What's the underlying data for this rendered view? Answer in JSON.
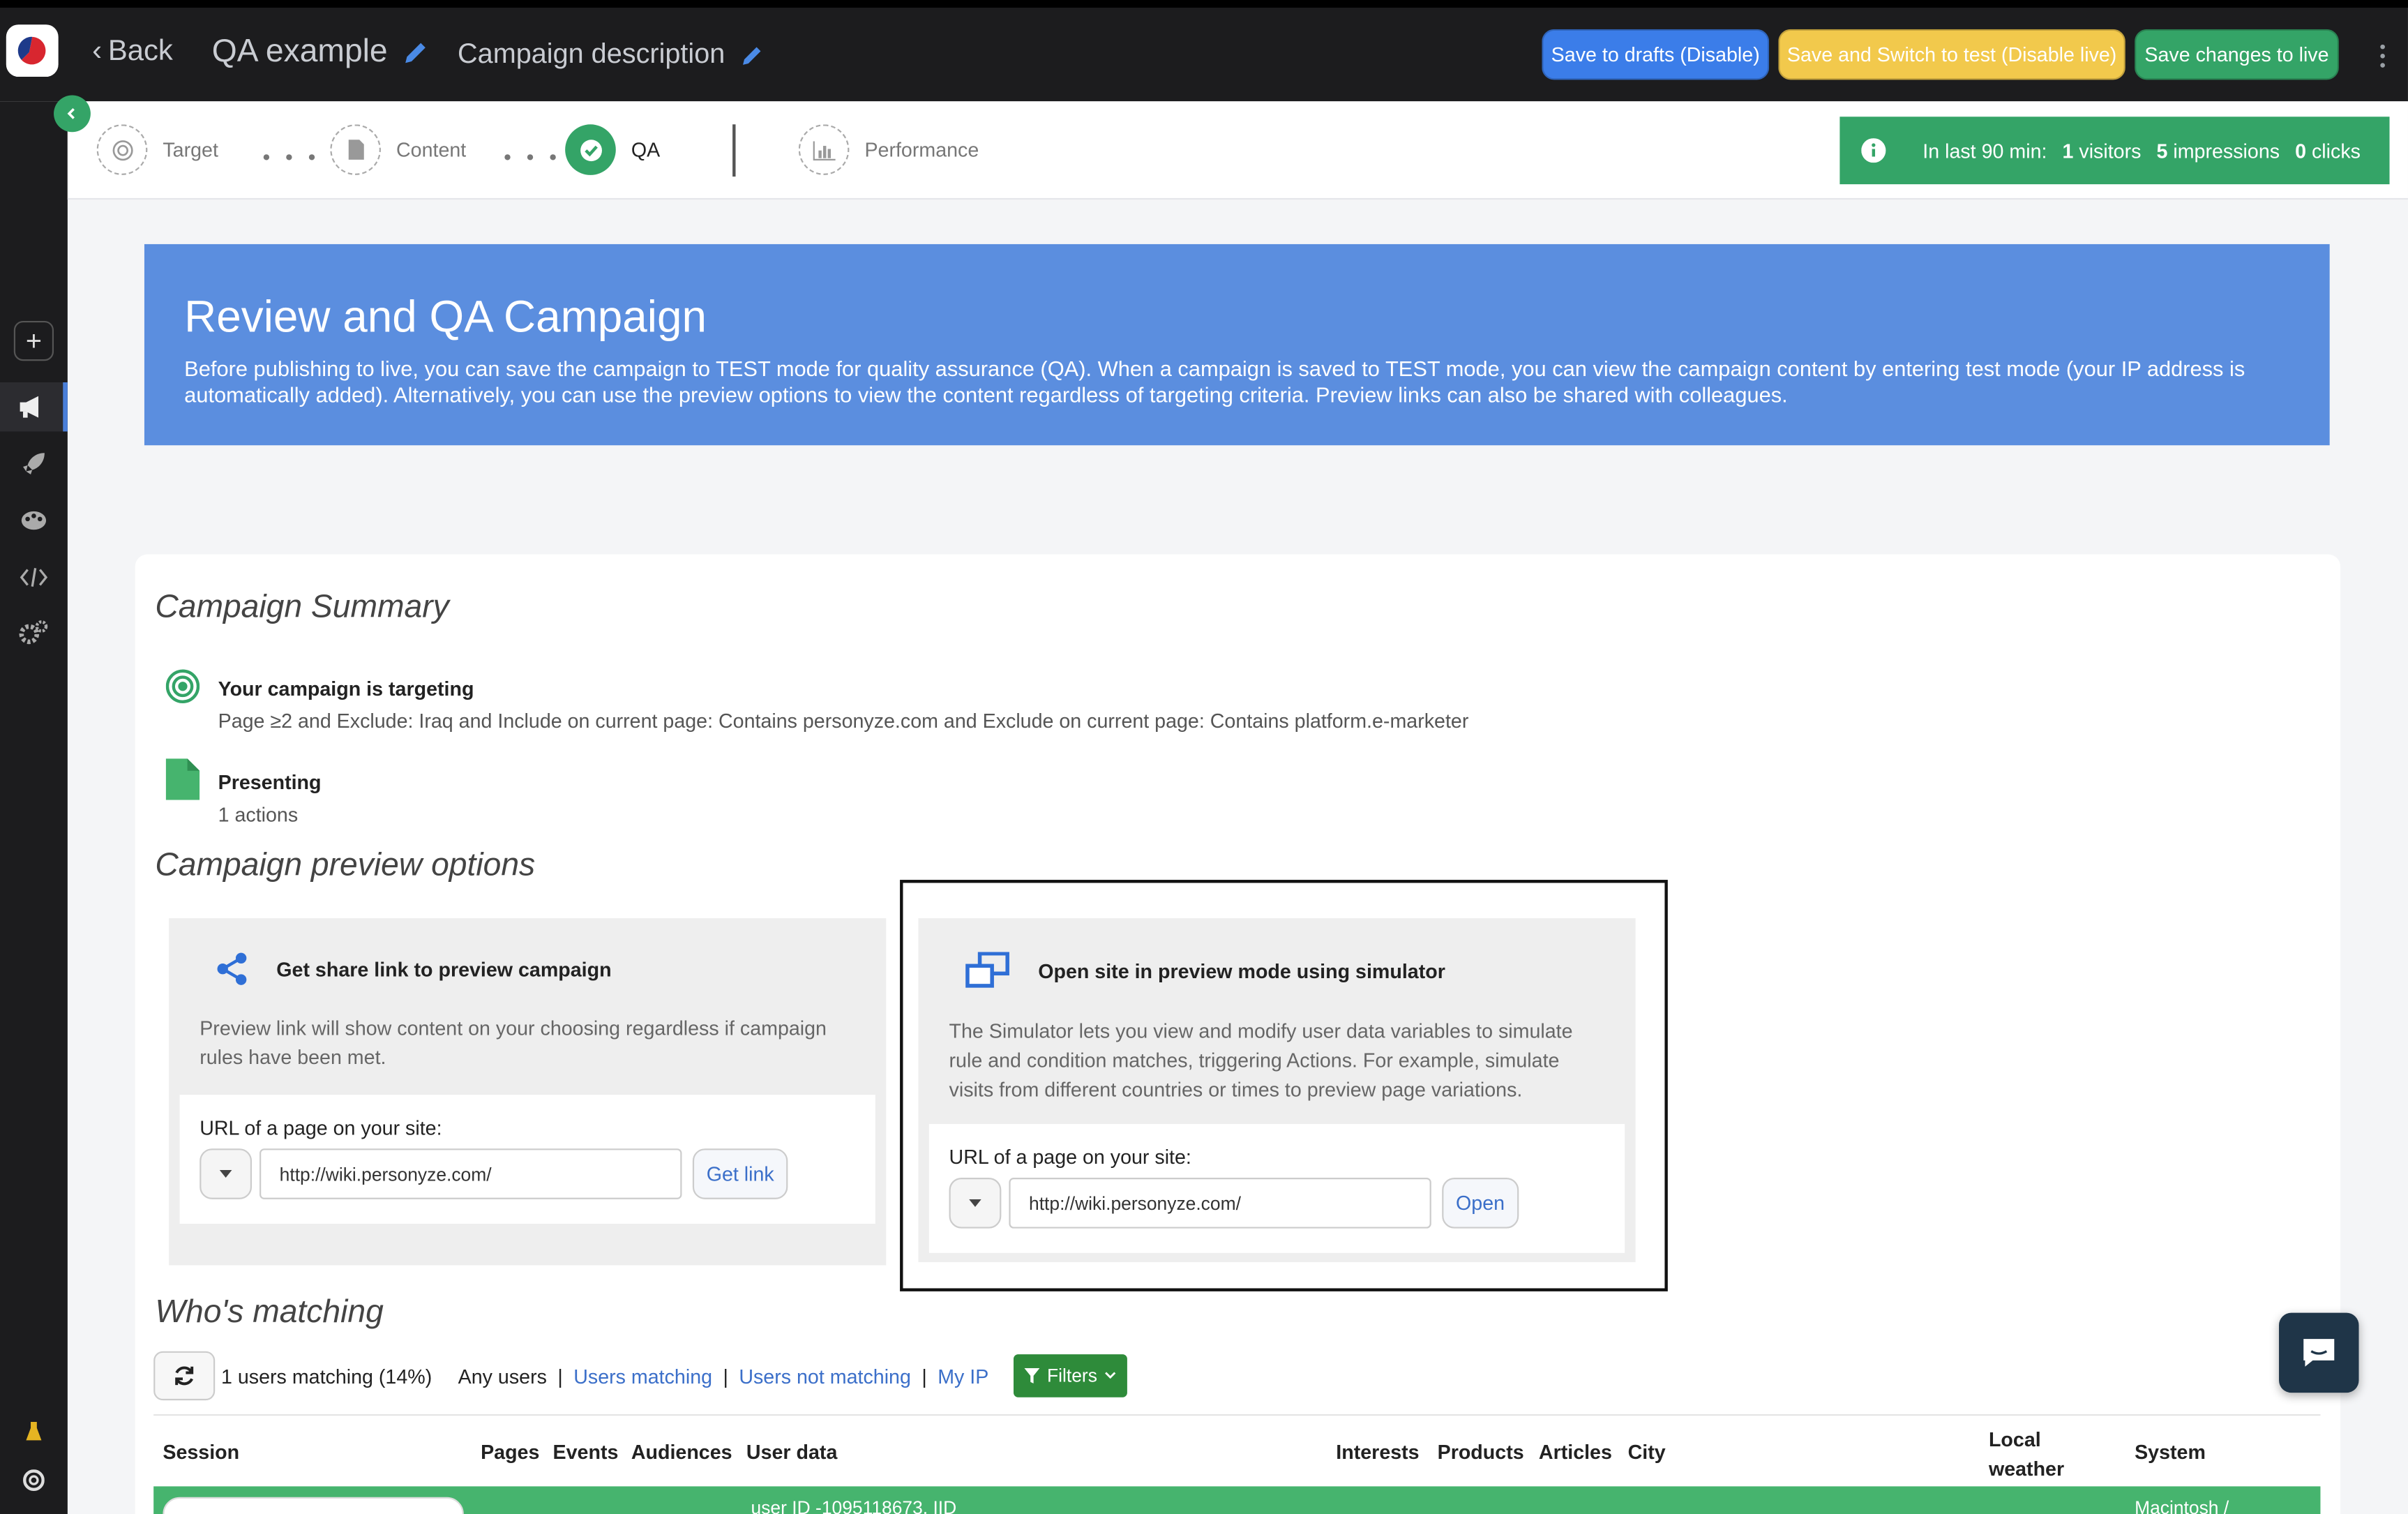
{
  "header": {
    "back_label": "Back",
    "campaign_title": "QA example",
    "campaign_description": "Campaign description",
    "save_drafts_label": "Save to drafts (Disable)",
    "save_test_label": "Save and Switch to test (Disable live)",
    "save_live_label": "Save changes to live"
  },
  "steps": [
    {
      "label": "Target",
      "state": "pending"
    },
    {
      "label": "Content",
      "state": "pending"
    },
    {
      "label": "QA",
      "state": "active"
    },
    {
      "label": "Performance",
      "state": "pending"
    }
  ],
  "stats": {
    "prefix": "In last 90 min:",
    "visitors_count": "1",
    "visitors_label": "visitors",
    "impressions_count": "5",
    "impressions_label": "impressions",
    "clicks_count": "0",
    "clicks_label": "clicks"
  },
  "banner": {
    "title": "Review and QA Campaign",
    "text": "Before publishing to live, you can save the campaign to TEST mode for quality assurance (QA). When a campaign is saved to TEST mode, you can view the campaign content by entering test mode (your IP address is automatically added). Alternatively, you can use the preview options to view the content regardless of targeting criteria. Preview links can also be shared with colleagues."
  },
  "summary": {
    "title": "Campaign Summary",
    "targeting_title": "Your campaign is targeting",
    "targeting_text": "Page ≥2 and Exclude: Iraq and Include on current page: Contains personyze.com and Exclude on current page: Contains platform.e-marketer",
    "presenting_title": "Presenting",
    "presenting_text": "1 actions"
  },
  "preview": {
    "title": "Campaign preview options",
    "share": {
      "title": "Get share link to preview campaign",
      "description": "Preview link will show content on your choosing regardless if campaign rules have been met.",
      "url_label": "URL of a page on your site:",
      "url_value": "http://wiki.personyze.com/",
      "button_label": "Get link"
    },
    "simulator": {
      "title": "Open site in preview mode using simulator",
      "description": "The Simulator lets you view and modify user data variables to simulate rule and condition matches, triggering Actions. For example, simulate visits from different countries or times to preview page variations.",
      "url_label": "URL of a page on your site:",
      "url_value": "http://wiki.personyze.com/",
      "button_label": "Open"
    }
  },
  "matching": {
    "title": "Who's matching",
    "count_text": "1 users matching (14%)",
    "filter_any": "Any users",
    "filter_matching": "Users matching",
    "filter_not_matching": "Users not matching",
    "filter_my_ip": "My IP",
    "filters_button": "Filters",
    "columns": {
      "session": "Session",
      "pages": "Pages",
      "events": "Events",
      "audiences": "Audiences",
      "user_data": "User data",
      "interests": "Interests",
      "products": "Products",
      "articles": "Articles",
      "city": "City",
      "local_weather_1": "Local",
      "local_weather_2": "weather",
      "system": "System"
    },
    "row": {
      "user_data": "user ID -1095118673, IID",
      "system": "Macintosh /"
    }
  },
  "colors": {
    "accent_green": "#34a467",
    "banner_blue": "#5b8edf",
    "drafts_blue": "#3b7de9",
    "test_yellow": "#f2c94c",
    "link_blue": "#3b6fc9"
  }
}
